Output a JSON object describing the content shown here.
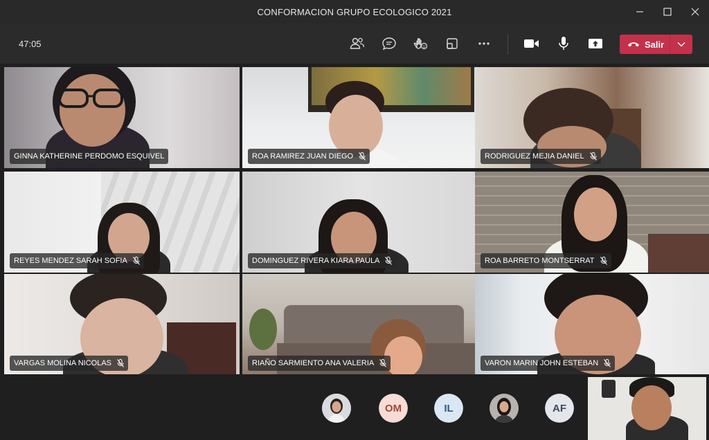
{
  "window": {
    "title": "CONFORMACION GRUPO ECOLOGICO 2021"
  },
  "toolbar": {
    "timer": "47:05",
    "buttons": [
      "participants-icon",
      "chat-icon",
      "reactions-icon",
      "breakout-rooms-icon",
      "more-options-icon",
      "camera-icon",
      "microphone-icon",
      "share-screen-icon"
    ],
    "leave_label": "Salir",
    "leave_color": "#c4314b"
  },
  "participants": [
    {
      "name": "GINNA KATHERINE PERDOMO ESQUIVEL",
      "muted": false
    },
    {
      "name": "ROA RAMIREZ JUAN DIEGO",
      "muted": true
    },
    {
      "name": "RODRIGUEZ MEJIA DANIEL",
      "muted": true
    },
    {
      "name": "REYES MENDEZ SARAH SOFIA",
      "muted": true
    },
    {
      "name": "DOMINGUEZ RIVERA KIARA PAULA",
      "muted": true
    },
    {
      "name": "ROA BARRETO MONTSERRAT",
      "muted": true
    },
    {
      "name": "VARGAS MOLINA NICOLAS",
      "muted": true
    },
    {
      "name": "RIAÑO SARMIENTO ANA VALERIA",
      "muted": true
    },
    {
      "name": "VARON MARIN JOHN ESTEBAN",
      "muted": true
    }
  ],
  "overflow": [
    {
      "initials": "",
      "type": "photo"
    },
    {
      "initials": "OM",
      "type": "initials",
      "bg": "#f6dcd5",
      "fg": "#a3463a"
    },
    {
      "initials": "IL",
      "type": "initials",
      "bg": "#dbe7f4",
      "fg": "#2e5a86"
    },
    {
      "initials": "",
      "type": "photo"
    },
    {
      "initials": "AF",
      "type": "initials",
      "bg": "#e3e6ea",
      "fg": "#3c4a5c"
    }
  ]
}
